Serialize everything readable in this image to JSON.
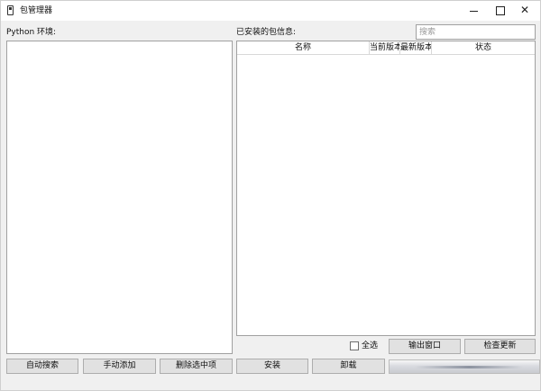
{
  "window": {
    "title": "包管理器",
    "controls": {
      "minimize": "—",
      "maximize": "□",
      "close": "✕"
    }
  },
  "env_panel": {
    "label": "Python 环境:",
    "items": []
  },
  "packages_panel": {
    "label": "已安装的包信息:",
    "search_placeholder": "搜索",
    "search_value": "",
    "columns": [
      "名称",
      "当前版本",
      "最新版本",
      "状态"
    ],
    "rows": []
  },
  "select_all": {
    "label": "全选",
    "checked": false
  },
  "buttons": {
    "output_window": "输出窗口",
    "check_updates": "检查更新",
    "auto_search": "自动搜索",
    "manual_add": "手动添加",
    "delete_selected": "删除选中项",
    "install": "安装",
    "uninstall": "卸载"
  },
  "progress": {
    "value": 1.0
  },
  "icons": {
    "app": "package-manager-icon",
    "minimize": "minimize-icon",
    "maximize": "maximize-icon",
    "close": "close-icon"
  }
}
